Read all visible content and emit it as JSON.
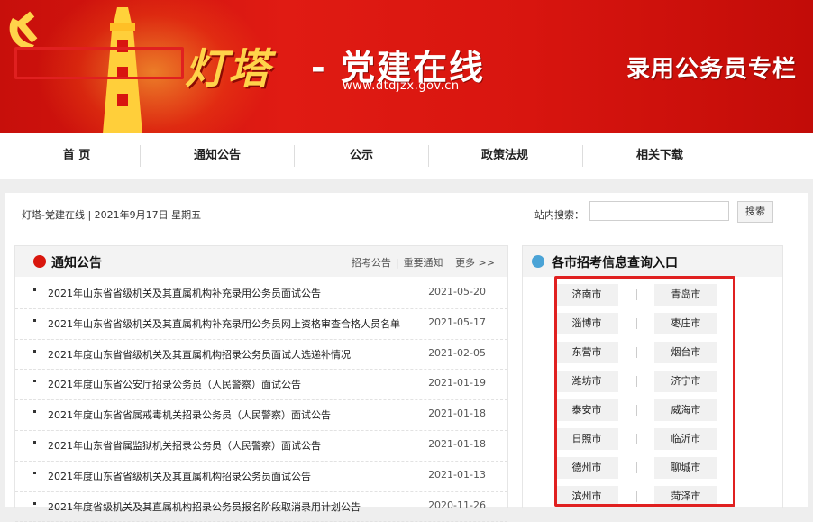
{
  "banner": {
    "logo_text": "灯塔",
    "logo_sub": "- 党建在线",
    "url": "www.dtdjzx.gov.cn",
    "column_title": "录用公务员专栏"
  },
  "nav": {
    "items": [
      "首 页",
      "通知公告",
      "公示",
      "政策法规",
      "相关下载"
    ]
  },
  "breadcrumb": "灯塔-党建在线 | 2021年9月17日 星期五",
  "search": {
    "label": "站内搜索：",
    "placeholder": "",
    "button_label": "搜索"
  },
  "notice": {
    "title": "通知公告",
    "links": [
      "招考公告",
      "重要通知",
      "更多 >>"
    ],
    "items": [
      {
        "title": "2021年山东省省级机关及其直属机构补充录用公务员面试公告",
        "date": "2021-05-20"
      },
      {
        "title": "2021年山东省省级机关及其直属机构补充录用公务员网上资格审查合格人员名单",
        "date": "2021-05-17"
      },
      {
        "title": "2021年度山东省省级机关及其直属机构招录公务员面试人选递补情况",
        "date": "2021-02-05"
      },
      {
        "title": "2021年度山东省公安厅招录公务员（人民警察）面试公告",
        "date": "2021-01-19"
      },
      {
        "title": "2021年度山东省省属戒毒机关招录公务员（人民警察）面试公告",
        "date": "2021-01-18"
      },
      {
        "title": "2021年山东省省属监狱机关招录公务员（人民警察）面试公告",
        "date": "2021-01-18"
      },
      {
        "title": "2021年度山东省省级机关及其直属机构招录公务员面试公告",
        "date": "2021-01-13"
      },
      {
        "title": "2021年度省级机关及其直属机构招录公务员报名阶段取消录用计划公告",
        "date": "2020-11-26"
      }
    ]
  },
  "cities": {
    "title": "各市招考信息查询入口",
    "items": [
      "济南市",
      "青岛市",
      "淄博市",
      "枣庄市",
      "东营市",
      "烟台市",
      "潍坊市",
      "济宁市",
      "泰安市",
      "威海市",
      "日照市",
      "临沂市",
      "德州市",
      "聊城市",
      "滨州市",
      "菏泽市"
    ]
  },
  "colors": {
    "banner_red": "#d8150f",
    "logo_gold": "#ffd34a",
    "highlight_red": "#e02020"
  }
}
